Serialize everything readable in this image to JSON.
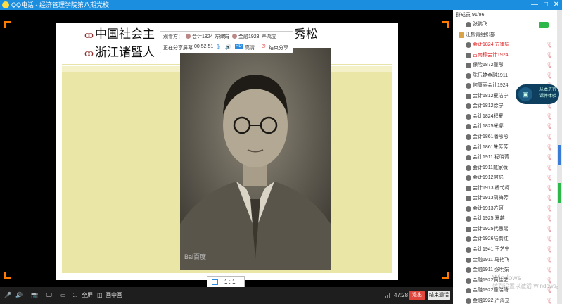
{
  "window": {
    "title": "QQ电话 - 经济管理学院第八期党校",
    "minimize": "—",
    "maximize": "□",
    "close": "✕"
  },
  "slide": {
    "line1": "中国社会主",
    "line1_tail": "秀松",
    "line2": "浙江诸暨人",
    "bullet": "ꝏ",
    "watermark": "Bai百度"
  },
  "share_panel": {
    "viewer_label": "观看方：",
    "viewer1": "会计1824 方律娟",
    "viewer2": "金融1923",
    "viewer2_extra": "严鸿立",
    "status": "正在分享屏幕",
    "elapsed": "00:52:51",
    "clarity_badge": "HD",
    "clarity": "高清",
    "stop": "结束分享"
  },
  "zoom": {
    "label": "1 : 1"
  },
  "toolbar": {
    "fullscreen": "全屏",
    "pip": "画中画",
    "timer": "47:28",
    "exit": "退出",
    "end": "结束通话"
  },
  "sidebar": {
    "header": "群成员 91/96",
    "members": [
      {
        "name": "张鹏飞",
        "type": "member"
      },
      {
        "name": "汪柳青组织部",
        "type": "group"
      },
      {
        "name": "会计1824 方律娟",
        "type": "speaking"
      },
      {
        "name": "古南穆会计1924",
        "type": "speaking"
      },
      {
        "name": "保险1872董彤",
        "type": "member"
      },
      {
        "name": "陈乐婷金融1911",
        "type": "member"
      },
      {
        "name": "何康丽会计1924",
        "type": "member"
      },
      {
        "name": "会计1812夏洁宁",
        "type": "member"
      },
      {
        "name": "会计1812徐宁",
        "type": "member"
      },
      {
        "name": "会计1824程夏",
        "type": "member"
      },
      {
        "name": "会计1825米娜",
        "type": "member"
      },
      {
        "name": "会计1861潘彤彤",
        "type": "member"
      },
      {
        "name": "会计1861朱芳芳",
        "type": "member"
      },
      {
        "name": "会计1911 程晓菁",
        "type": "member"
      },
      {
        "name": "会计1911戴家薇",
        "type": "member"
      },
      {
        "name": "会计1912何忆",
        "type": "member"
      },
      {
        "name": "会计1913 杨弋柯",
        "type": "member"
      },
      {
        "name": "会计1913周梅芳",
        "type": "member"
      },
      {
        "name": "会计1913方珂",
        "type": "member"
      },
      {
        "name": "会计1925 夏越",
        "type": "member"
      },
      {
        "name": "会计1925代思瑶",
        "type": "member"
      },
      {
        "name": "会计1926陆韵红",
        "type": "member"
      },
      {
        "name": "会计1941 王艺宁",
        "type": "member"
      },
      {
        "name": "金融1911 马艳飞",
        "type": "member"
      },
      {
        "name": "金融1911 张明娟",
        "type": "member"
      },
      {
        "name": "金融1922黄佳艺",
        "type": "member"
      },
      {
        "name": "金融1922童瑞琦",
        "type": "member"
      },
      {
        "name": "金融1922 严鸿立",
        "type": "member"
      }
    ]
  },
  "float_tip": {
    "line1": "从本进行",
    "line2": "课件体验"
  },
  "win_watermark": {
    "line1": "Windows",
    "line2": "转到设置以激活 Windows。"
  },
  "colors": {
    "titlebar": "#1c8ee0",
    "accent_orange": "#ff7a00",
    "exit_red": "#e0463c",
    "speaking_red": "#e02222"
  }
}
